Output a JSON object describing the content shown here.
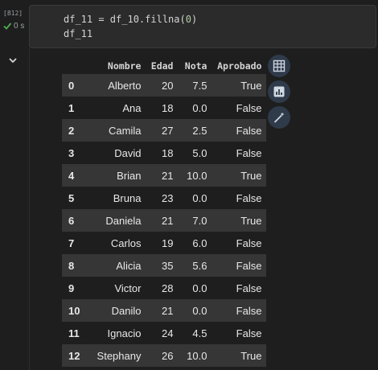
{
  "cell": {
    "execution_count": "[812]",
    "run_time": "0 s",
    "code": {
      "line1_var": "df_11 = df_10.fillna(",
      "line1_arg": "0",
      "line1_close": ")",
      "line2": "df_11"
    }
  },
  "table": {
    "columns": [
      "Nombre",
      "Edad",
      "Nota",
      "Aprobado"
    ],
    "rows": [
      {
        "idx": "0",
        "nombre": "Alberto",
        "edad": "20",
        "nota": "7.5",
        "aprobado": "True"
      },
      {
        "idx": "1",
        "nombre": "Ana",
        "edad": "18",
        "nota": "0.0",
        "aprobado": "False"
      },
      {
        "idx": "2",
        "nombre": "Camila",
        "edad": "27",
        "nota": "2.5",
        "aprobado": "False"
      },
      {
        "idx": "3",
        "nombre": "David",
        "edad": "18",
        "nota": "5.0",
        "aprobado": "False"
      },
      {
        "idx": "4",
        "nombre": "Brian",
        "edad": "21",
        "nota": "10.0",
        "aprobado": "True"
      },
      {
        "idx": "5",
        "nombre": "Bruna",
        "edad": "23",
        "nota": "0.0",
        "aprobado": "False"
      },
      {
        "idx": "6",
        "nombre": "Daniela",
        "edad": "21",
        "nota": "7.0",
        "aprobado": "True"
      },
      {
        "idx": "7",
        "nombre": "Carlos",
        "edad": "19",
        "nota": "6.0",
        "aprobado": "False"
      },
      {
        "idx": "8",
        "nombre": "Alicia",
        "edad": "35",
        "nota": "5.6",
        "aprobado": "False"
      },
      {
        "idx": "9",
        "nombre": "Victor",
        "edad": "28",
        "nota": "0.0",
        "aprobado": "False"
      },
      {
        "idx": "10",
        "nombre": "Danilo",
        "edad": "21",
        "nota": "0.0",
        "aprobado": "False"
      },
      {
        "idx": "11",
        "nombre": "Ignacio",
        "edad": "24",
        "nota": "4.5",
        "aprobado": "False"
      },
      {
        "idx": "12",
        "nombre": "Stephany",
        "edad": "26",
        "nota": "10.0",
        "aprobado": "True"
      }
    ]
  },
  "actions": {
    "icons": [
      "table-view-icon",
      "chart-suggest-icon",
      "magic-wand-icon"
    ]
  },
  "colors": {
    "background": "#1e1e1e",
    "odd_row": "#363636",
    "success": "#4caf50",
    "number_literal": "#b5cea8"
  }
}
